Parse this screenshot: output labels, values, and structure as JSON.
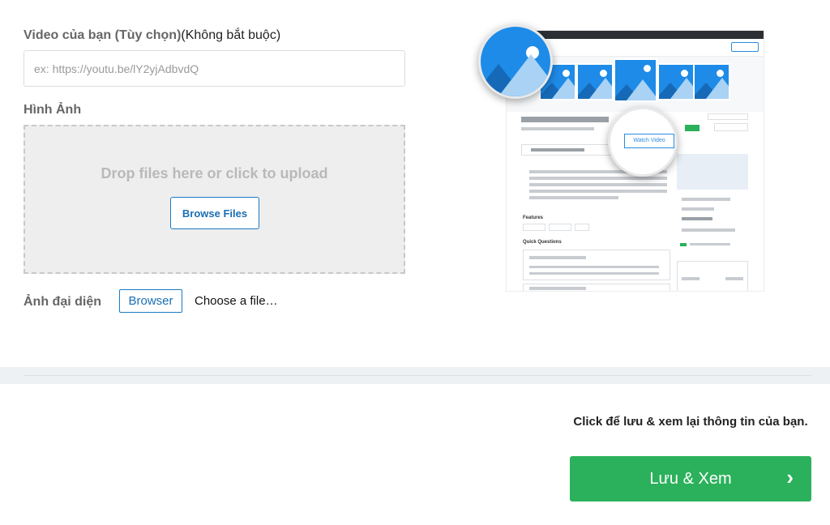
{
  "video": {
    "label": "Video của bạn (Tùy chọn)",
    "optional_note": "(Không bắt buộc)",
    "placeholder": "ex: https://youtu.be/lY2yjAdbvdQ",
    "value": ""
  },
  "images": {
    "label": "Hình Ảnh",
    "drop_text": "Drop files here or click to upload",
    "browse_label": "Browse Files"
  },
  "avatar": {
    "label": "Ảnh đại diện",
    "browse_label": "Browser",
    "file_text": "Choose a file…"
  },
  "preview": {
    "watch_video_label": "Watch Video"
  },
  "footer": {
    "hint": "Click để lưu & xem lại thông tin của bạn.",
    "save_label": "Lưu & Xem",
    "save_icon": "chevron-right-icon"
  },
  "colors": {
    "accent_blue": "#1a7ac4",
    "save_green": "#2bb15b"
  }
}
